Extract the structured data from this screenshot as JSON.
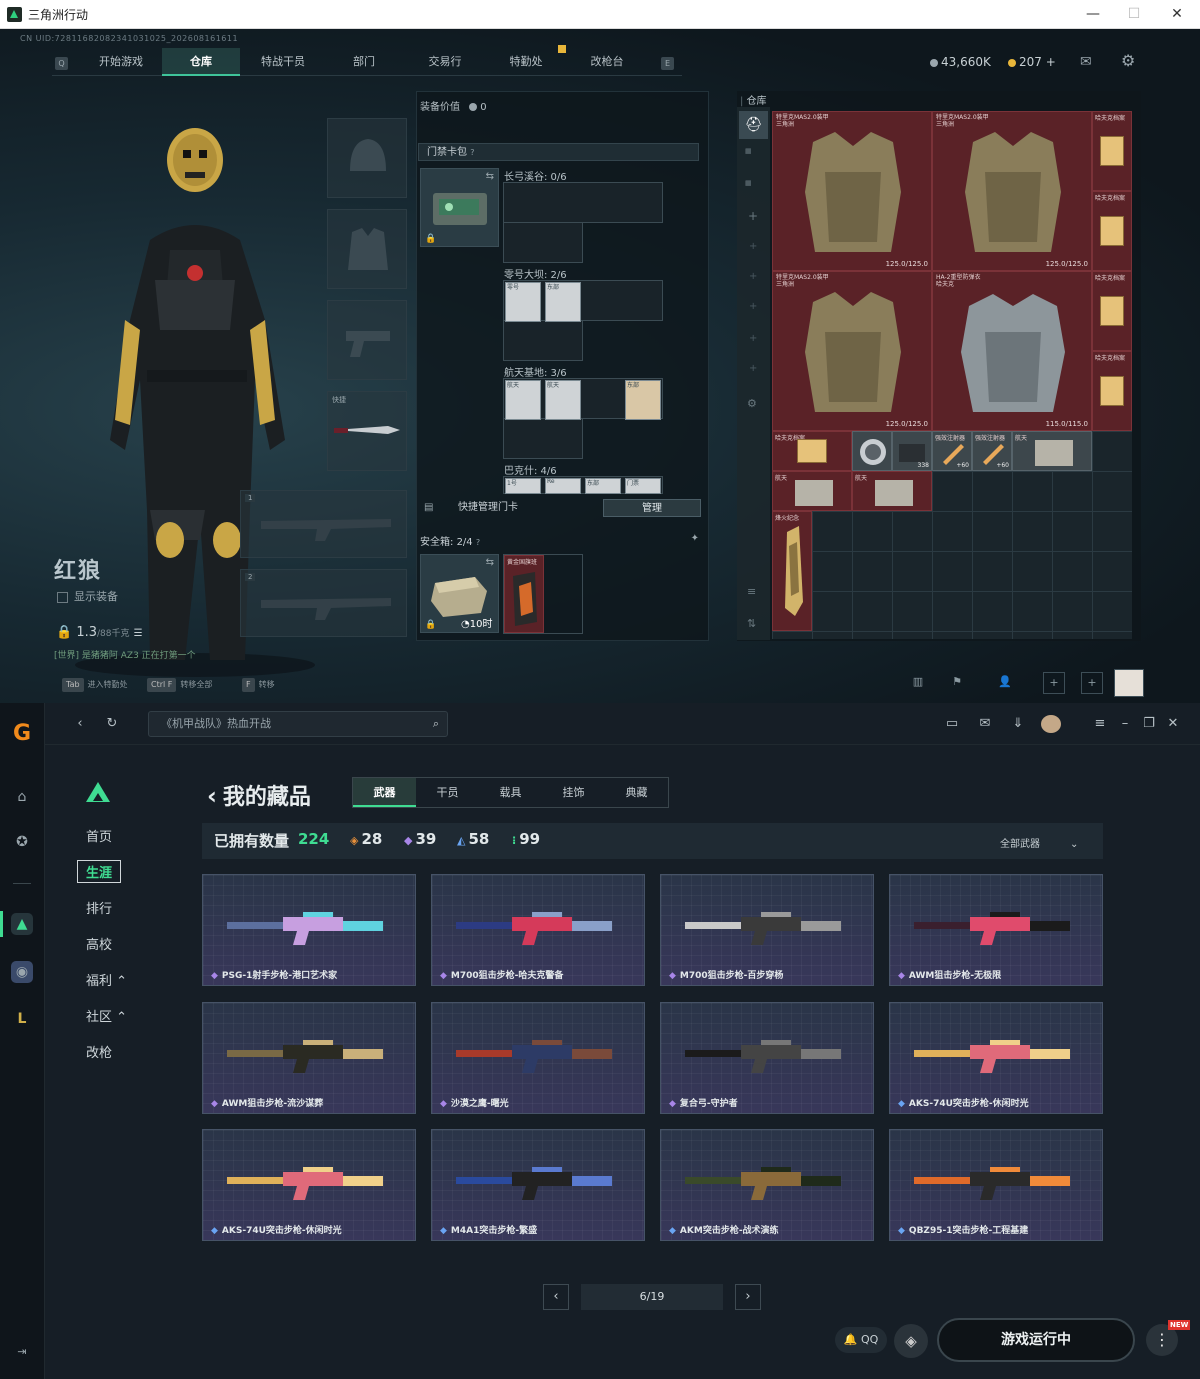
{
  "game_window": {
    "title": "三角洲行动",
    "controls": [
      "—",
      "☐",
      "✕"
    ],
    "cn_id": "CN UID:7281168208234103102​5_202608161611",
    "nav_keys": [
      "Q",
      "E"
    ],
    "nav_tabs": [
      "开始游戏",
      "仓库",
      "特战干员",
      "部门",
      "交易行",
      "特勤处",
      "改枪台"
    ],
    "active_tab": "仓库",
    "currency_1": "43,660K",
    "currency_2": "207 +",
    "character": {
      "name": "红狼",
      "show_equipment": "显示装备",
      "weight": "1.3",
      "weight_max": "/88千克",
      "chat": "[世界] 是猪猪阿 AZ3 正在打第一个"
    },
    "gear_slots": {
      "melee_label": "快捷",
      "slot1": "1",
      "slot2": "2"
    },
    "hints": [
      {
        "key": "Tab",
        "text": "进入特勤处"
      },
      {
        "key": "Ctrl F",
        "text": "转移全部"
      },
      {
        "key": "F",
        "text": "转移"
      }
    ],
    "equipment_panel": {
      "value_label": "装备价值",
      "value": "0",
      "pouch": "门禁卡包",
      "zones": [
        "长弓溪谷: 0/6",
        "零号大坝: 2/6",
        "航天基地: 3/6",
        "巴克什: 4/6"
      ],
      "card_labels": [
        "零号",
        "东部",
        "航天",
        "航天",
        "东部",
        "1号",
        "Re",
        "东部",
        "门票"
      ],
      "quick_manage": "快捷管理门卡",
      "manage_btn": "管理",
      "safe_label": "安全箱:",
      "safe_value": "2/4",
      "safe_time": "10时",
      "safe_item": "黄金国旗班"
    },
    "warehouse": {
      "title": "仓库",
      "armors": [
        {
          "name": "特里克MAS2.0装甲",
          "sub": "三角洲",
          "dur": "125.0/125.0"
        },
        {
          "name": "特里克MAS2.0装甲",
          "sub": "三角洲",
          "dur": "125.0/125.0"
        },
        {
          "name": "特里克MAS2.0装甲",
          "sub": "三角洲",
          "dur": "125.0/125.0"
        },
        {
          "name": "HA-2重型防弹衣",
          "sub": "哈夫克",
          "dur": "115.0/115.0"
        }
      ],
      "side_items": [
        "哈夫克档案",
        "哈夫克档案",
        "哈夫克档案",
        "哈夫克档案",
        "哈夫克档案"
      ],
      "row_items": [
        {
          "label": "哈夫克档案",
          "count": ""
        },
        {
          "label": "",
          "count": ""
        },
        {
          "label": "",
          "count": "338"
        },
        {
          "label": "强效注射器",
          "count": "+60"
        },
        {
          "label": "强效注射器",
          "count": "+60"
        },
        {
          "label": "航天",
          "count": ""
        }
      ],
      "row2_items": [
        "航天",
        "航天"
      ],
      "trophy_label": "烽火纪念"
    }
  },
  "launcher": {
    "search_placeholder": "《机甲战队》热血开战",
    "left_nav": [
      "首页",
      "生涯",
      "排行",
      "高校",
      "福利 ⌃",
      "社区 ⌃",
      "改枪"
    ],
    "active_nav": "生涯",
    "page_title": "我的藏品",
    "tabs": [
      "武器",
      "干员",
      "载具",
      "挂饰",
      "典藏"
    ],
    "active_tab": "武器",
    "owned_label": "已拥有数量",
    "owned_count": "224",
    "rarity_counts": [
      {
        "icon": "◈",
        "value": "28",
        "color": "#e8903a"
      },
      {
        "icon": "◆",
        "value": "39",
        "color": "#a886e8"
      },
      {
        "icon": "◭",
        "value": "58",
        "color": "#6aa5f3"
      },
      {
        "icon": "⁝",
        "value": "99",
        "color": "#3fdc92"
      }
    ],
    "filter": "全部武器",
    "weapons": [
      {
        "name": "PSG-1射手步枪-港口艺术家",
        "rarity": "purple",
        "colors": [
          "#5c6f9e",
          "#c79fe0",
          "#5fd3e0"
        ]
      },
      {
        "name": "M700狙击步枪-哈夫克警备",
        "rarity": "purple",
        "colors": [
          "#2c3b83",
          "#d53a5a",
          "#8aa0c9"
        ]
      },
      {
        "name": "M700狙击步枪-百步穿杨",
        "rarity": "purple",
        "colors": [
          "#c9c9c9",
          "#3a3a3a",
          "#9a9a9a"
        ]
      },
      {
        "name": "AWM狙击步枪-无极限",
        "rarity": "purple",
        "colors": [
          "#3a1f2e",
          "#e04b6c",
          "#1b1b1b"
        ]
      },
      {
        "name": "AWM狙击步枪-流沙谋葬",
        "rarity": "purple",
        "colors": [
          "#7a6a45",
          "#2a2a22",
          "#c9b07a"
        ]
      },
      {
        "name": "沙漠之鹰-曙光",
        "rarity": "purple",
        "colors": [
          "#a83a2a",
          "#2d3b66",
          "#7a4a3a"
        ]
      },
      {
        "name": "复合弓-守护者",
        "rarity": "purple",
        "colors": [
          "#1b1b1b",
          "#444444",
          "#777777"
        ]
      },
      {
        "name": "AKS-74U突击步枪-休闲时光",
        "rarity": "blue",
        "colors": [
          "#e0b15a",
          "#e06a7a",
          "#f0d08a"
        ]
      },
      {
        "name": "AKS-74U突击步枪-休闲时光",
        "rarity": "blue",
        "colors": [
          "#e0b15a",
          "#e06a7a",
          "#f0d08a"
        ]
      },
      {
        "name": "M4A1突击步枪-繁盛",
        "rarity": "blue",
        "colors": [
          "#2a4a9e",
          "#222222",
          "#5a7ad0"
        ]
      },
      {
        "name": "AKM突击步枪-战术演练",
        "rarity": "blue",
        "colors": [
          "#3a4a2a",
          "#8a6a3a",
          "#1f2a1a"
        ]
      },
      {
        "name": "QBZ95-1突击步枪-工程基建",
        "rarity": "blue",
        "colors": [
          "#e06a2a",
          "#2a2a2a",
          "#f08a3a"
        ]
      }
    ],
    "pager": {
      "prev": "‹",
      "page": "6/19",
      "next": "›"
    },
    "qq_label": "QQ",
    "run_label": "游戏运行中",
    "new_badge": "NEW"
  }
}
